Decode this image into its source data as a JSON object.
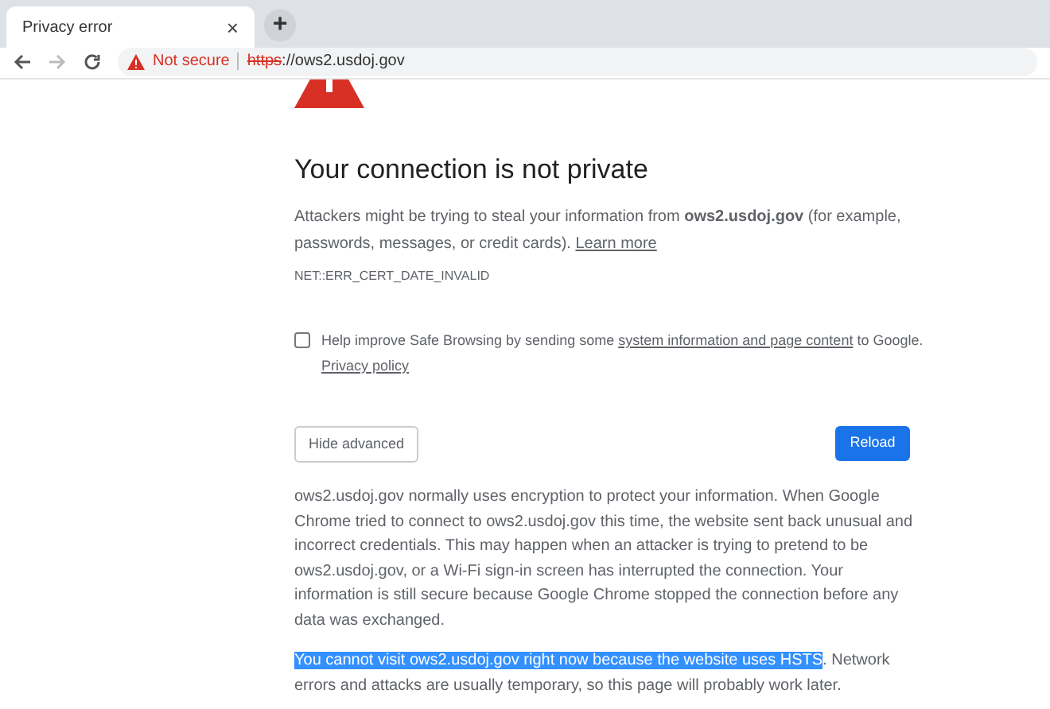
{
  "tab": {
    "title": "Privacy error",
    "close": "×",
    "new_tab": "+"
  },
  "toolbar": {
    "security": "Not secure",
    "url_scheme": "https",
    "url_rest": "://ows2.usdoj.gov"
  },
  "page": {
    "heading": "Your connection is not private",
    "intro": "Attackers might be trying to steal your information from **ows2.usdoj.gov** (for example, passwords, messages, or credit cards).",
    "learn_more": "Learn more",
    "error_code": "NET::ERR_CERT_DATE_INVALID",
    "safe_browsing": {
      "checked": false,
      "before": "Help improve Safe Browsing by sending some",
      "link": "system information and page content",
      "after": "to Google.",
      "privacy_link": "Privacy policy"
    },
    "hide_advanced": "Hide advanced",
    "reload": "Reload",
    "details": "ows2.usdoj.gov normally uses encryption to protect your information. When Google Chrome tried to connect to ows2.usdoj.gov this time, the website sent back unusual and incorrect credentials. This may happen when an attacker is trying to pretend to be ows2.usdoj.gov, or a Wi-Fi sign-in screen has interrupted the connection. Your information is still secure because Google Chrome stopped the connection before any data was exchanged.",
    "hsts": {
      "highlighted": "You cannot visit ows2.usdoj.gov right now because the website uses HSTS",
      "rest": ". Network errors and attacks are usually temporary, so this page will probably work later."
    }
  }
}
